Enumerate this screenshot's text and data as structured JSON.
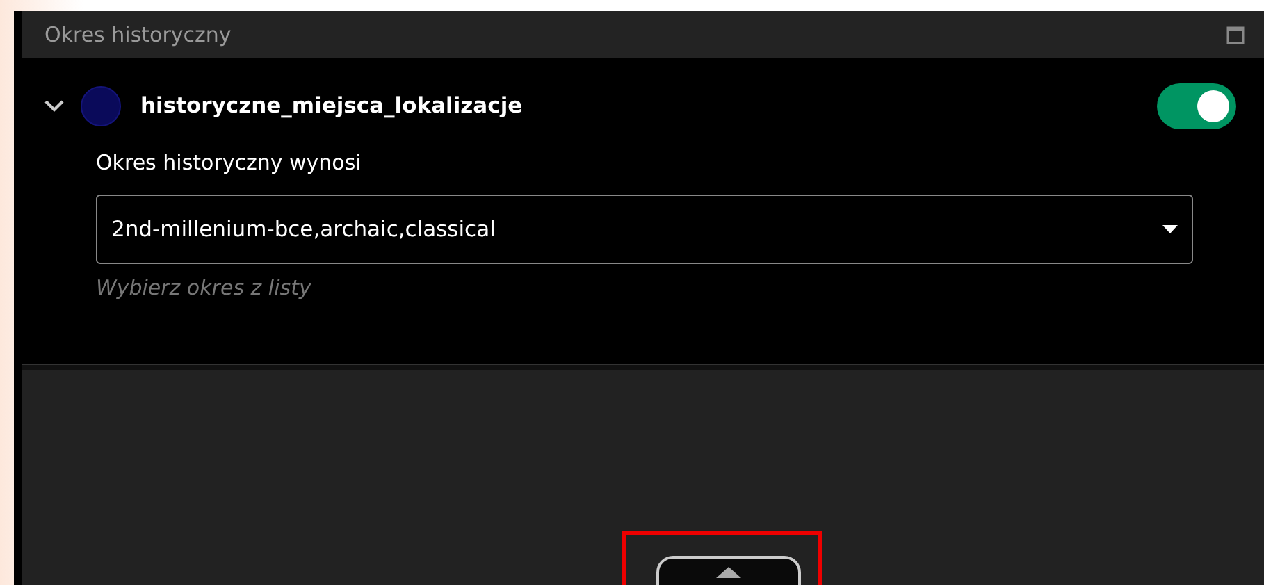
{
  "panel": {
    "title": "Okres historyczny"
  },
  "layer": {
    "name": "historyczne_miejsca_lokalizacje",
    "expanded": true,
    "color": "#0a0a5a",
    "visible": true
  },
  "filter": {
    "label": "Okres historyczny wynosi",
    "value": "2nd-millenium-bce,archaic,classical",
    "hint": "Wybierz okres z listy"
  }
}
